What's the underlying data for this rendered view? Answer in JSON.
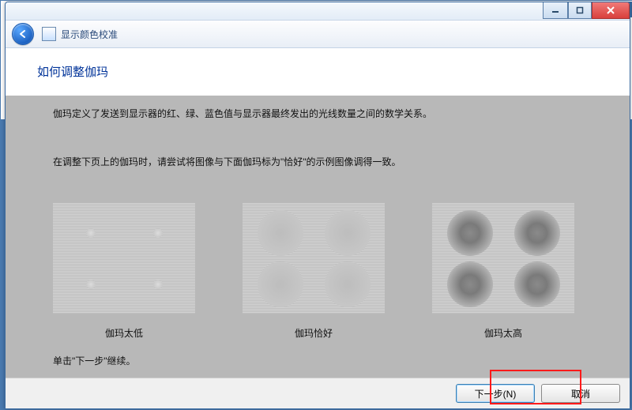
{
  "titlebar": {
    "app_title": "显示颜色校准"
  },
  "content": {
    "heading": "如何调整伽玛",
    "para1": "伽玛定义了发送到显示器的红、绿、蓝色值与显示器最终发出的光线数量之间的数学关系。",
    "para2": "在调整下页上的伽玛时，请尝试将图像与下面伽玛标为\"恰好\"的示例图像调得一致。",
    "continue_hint": "单击\"下一步\"继续。",
    "samples": {
      "low": "伽玛太低",
      "good": "伽玛恰好",
      "high": "伽玛太高"
    }
  },
  "footer": {
    "next": "下一步(N)",
    "cancel": "取消"
  }
}
